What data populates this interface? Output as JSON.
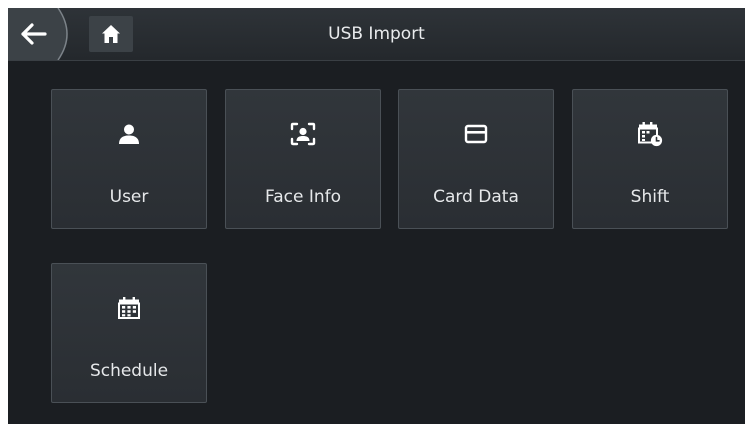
{
  "header": {
    "title": "USB Import",
    "back_icon": "back-arrow-icon",
    "home_icon": "home-icon"
  },
  "tiles": [
    {
      "label": "User",
      "icon": "user-icon"
    },
    {
      "label": "Face Info",
      "icon": "face-scan-icon"
    },
    {
      "label": "Card Data",
      "icon": "card-icon"
    },
    {
      "label": "Shift",
      "icon": "calendar-clock-icon"
    },
    {
      "label": "Schedule",
      "icon": "calendar-icon"
    }
  ],
  "colors": {
    "background": "#1b1e22",
    "tile": "#2e3338",
    "tile_border": "#4a5056",
    "text": "#e6e8ea"
  }
}
